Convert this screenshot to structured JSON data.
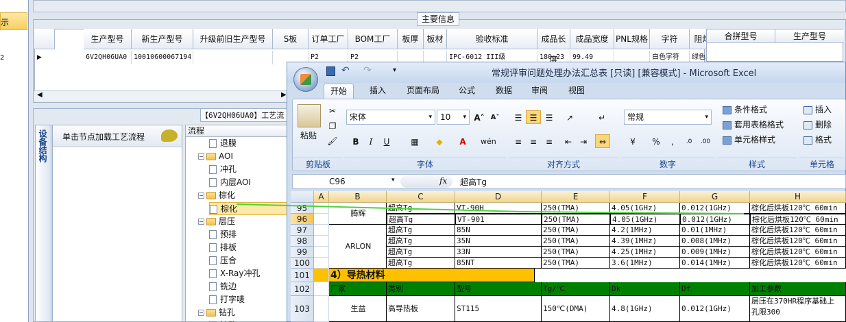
{
  "left": {
    "items": [
      "示",
      "2"
    ]
  },
  "top_panel": {
    "title": "主要信息"
  },
  "grid": {
    "headers": [
      "生产型号",
      "新生产型号",
      "升级前旧生产型号",
      "S板",
      "订单工厂",
      "BOM工厂",
      "板厚",
      "板材",
      "验收标准",
      "成品长度",
      "成品宽度",
      "PNL规格",
      "字符",
      "阻焊",
      "纟"
    ],
    "row": [
      "6V2QH06UA0",
      "10010600067194",
      "",
      "",
      "P2",
      "P2",
      "",
      "",
      "IPC-6012 III级",
      "180.23",
      "99.49",
      "",
      "白色字符",
      "绿色",
      "V2"
    ],
    "side_headers": [
      "合拼型号",
      "生产型号"
    ]
  },
  "proc": {
    "tab_label": "设备结构",
    "hint_label": "单击节点加载工艺流程",
    "title": "【6V2QH06UA0】工艺流",
    "tree_header": "流程",
    "tree": [
      {
        "t": "退膜",
        "k": "doc"
      },
      {
        "t": "AOI",
        "k": "fold"
      },
      {
        "t": "冲孔",
        "k": "doc"
      },
      {
        "t": "内层AOI",
        "k": "doc"
      },
      {
        "t": "棕化",
        "k": "fold"
      },
      {
        "t": "棕化",
        "k": "doc"
      },
      {
        "t": "层压",
        "k": "fold"
      },
      {
        "t": "预排",
        "k": "doc"
      },
      {
        "t": "排板",
        "k": "doc"
      },
      {
        "t": "压合",
        "k": "doc"
      },
      {
        "t": "X-Ray冲孔",
        "k": "doc"
      },
      {
        "t": "铣边",
        "k": "doc"
      },
      {
        "t": "打字唛",
        "k": "doc"
      },
      {
        "t": "钻孔",
        "k": "fold"
      },
      {
        "t": "钻孔",
        "k": "doc"
      }
    ]
  },
  "excel": {
    "title": "常规评审问题处理办法汇总表 [只读] [兼容模式] - Microsoft Excel",
    "tabs": [
      "开始",
      "插入",
      "页面布局",
      "公式",
      "数据",
      "审阅",
      "视图"
    ],
    "paste_label": "粘贴",
    "font_name": "宋体",
    "font_size": "10",
    "number_format": "常规",
    "groups": [
      "剪贴板",
      "字体",
      "对齐方式",
      "数字",
      "样式",
      "单元格"
    ],
    "style_buttons": [
      "条件格式",
      "套用表格格式",
      "单元格样式"
    ],
    "cell_buttons": [
      "插入",
      "删除",
      "格式"
    ],
    "name_box": "C96",
    "formula_label": "fx",
    "formula_value": "超高Tg",
    "columns": [
      "A",
      "B",
      "C",
      "D",
      "E",
      "F",
      "G",
      "H"
    ],
    "rows": [
      {
        "n": "95",
        "cells": [
          "",
          "腾辉",
          "超高Tg",
          "VT-90H",
          "250(TMA)",
          "4.05(1GHz)",
          "0.012(1GHz)",
          "棕化后烘板120℃ 60min"
        ]
      },
      {
        "n": "96",
        "cells": [
          "",
          "",
          "超高Tg",
          "VT-901",
          "250(TMA)",
          "4.05(1GHz)",
          "0.012(1GHz)",
          "棕化后烘板120℃ 60min"
        ]
      },
      {
        "n": "97",
        "cells": [
          "",
          "ARLON",
          "超高Tg",
          "85N",
          "250(TMA)",
          "4.2(1MHz)",
          "0.01(1MHz)",
          "棕化后烘板120℃ 60min"
        ]
      },
      {
        "n": "98",
        "cells": [
          "",
          "",
          "超高Tg",
          "35N",
          "250(TMA)",
          "4.39(1MHz)",
          "0.008(1MHz)",
          "棕化后烘板120℃ 60min"
        ]
      },
      {
        "n": "99",
        "cells": [
          "",
          "",
          "超高Tg",
          "33N",
          "250(TMA)",
          "4.25(1MHz)",
          "0.009(1MHz)",
          "棕化后烘板120℃ 60min"
        ]
      },
      {
        "n": "100",
        "cells": [
          "",
          "",
          "超高Tg",
          "85NT",
          "250(TMA)",
          "3.6(1MHz)",
          "0.014(1MHz)",
          "棕化后烘板120℃ 60min"
        ]
      },
      {
        "n": "101",
        "cells": [
          "",
          "4）导热材料",
          "",
          "",
          "",
          "",
          "",
          ""
        ]
      },
      {
        "n": "102",
        "cells": [
          "",
          "厂家",
          "类别",
          "型号",
          "Tg/℃",
          "Dk",
          "Df",
          "加工参数"
        ]
      },
      {
        "n": "103",
        "cells": [
          "",
          "生益",
          "高导热板",
          "ST115",
          "150℃(DMA)",
          "4.8(1GHz)",
          "0.012(1GHz)",
          "层压在370HR程序基础上 孔限300"
        ]
      }
    ]
  },
  "colors": {
    "accent": "#e2b33c",
    "excel_title": "#cfddef",
    "section_bg": "#ffc000",
    "header_bg": "#008000"
  }
}
